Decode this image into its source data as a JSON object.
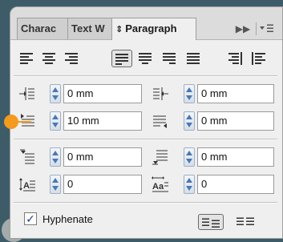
{
  "tabs": [
    {
      "label": "Charac",
      "active": false
    },
    {
      "label": "Text W",
      "active": false
    },
    {
      "label": "Paragraph",
      "active": true
    }
  ],
  "tab_controls": {
    "expand_icon": "double-chevron-right",
    "menu_icon": "panel-menu"
  },
  "alignment_buttons": [
    {
      "name": "align-left",
      "selected": false
    },
    {
      "name": "align-center",
      "selected": false
    },
    {
      "name": "align-right",
      "selected": false
    },
    {
      "name": "justify-last-left",
      "selected": true
    },
    {
      "name": "justify-last-center",
      "selected": false
    },
    {
      "name": "justify-last-right",
      "selected": false
    },
    {
      "name": "justify-all",
      "selected": false
    },
    {
      "name": "align-towards-spine",
      "selected": false
    },
    {
      "name": "align-away-from-spine",
      "selected": false
    }
  ],
  "fields": {
    "left_indent": "0 mm",
    "right_indent": "0 mm",
    "first_line_indent": "10 mm",
    "last_line_indent": "0 mm",
    "space_before": "0 mm",
    "space_after": "0 mm",
    "drop_cap_lines": "0",
    "drop_cap_chars": "0"
  },
  "hyphenate": {
    "label": "Hyphenate",
    "checked": true,
    "checkmark": "✓"
  },
  "colors": {
    "panel_bg": "#efefef",
    "accent_spinner": "#4a78b5",
    "annotation_orange": "#f39a1f"
  }
}
